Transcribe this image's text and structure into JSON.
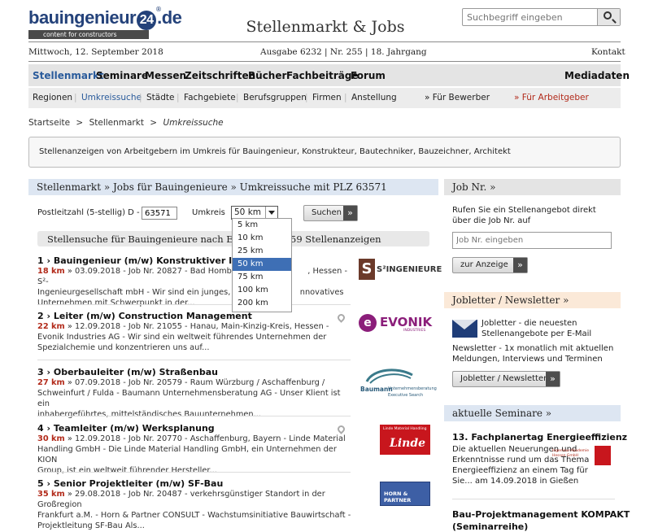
{
  "brand": {
    "logo_main": "bauingenieur",
    "logo_num": "24",
    "logo_tld": ".de",
    "logo_tagline": "content for constructors",
    "site_title": "Stellenmarkt & Jobs"
  },
  "search": {
    "placeholder": "Suchbegriff eingeben",
    "icon": "search-icon"
  },
  "dateline": {
    "date": "Mittwoch, 12. September 2018",
    "issue": "Ausgabe 6232 | Nr. 255 | 18. Jahrgang",
    "contact": "Kontakt"
  },
  "nav_main": {
    "items": [
      "Stellenmarkt",
      "Seminare",
      "Messen",
      "Zeitschriften",
      "Bücher",
      "Fachbeiträge",
      "Forum"
    ],
    "right": "Mediadaten",
    "active_color": "#2a5b9b"
  },
  "nav_sub": {
    "items": [
      "Regionen",
      "Umkreissuche",
      "Städte",
      "Fachgebiete",
      "Berufsgruppen",
      "Firmen",
      "Anstellung"
    ],
    "bewerber": "» Für Bewerber",
    "arbeitgeber": "» Für Arbeitgeber"
  },
  "breadcrumb": {
    "home": "Startseite",
    "sep": ">",
    "level1": "Stellenmarkt",
    "current": "Umkreissuche"
  },
  "intro_text": "Stellenanzeigen von Arbeitgebern im Umkreis für Bauingenieur, Konstrukteur, Bautechniker, Bauzeichner, Architekt",
  "main_panel": {
    "heading": "Stellenmarkt » Jobs für Bauingenieure » Umkreissuche mit PLZ 63571",
    "plz_label": "Postleitzahl (5-stellig)  D -",
    "plz_value": "63571",
    "radius_label": "Umkreis",
    "radius_selected": "50 km",
    "radius_options": [
      "5 km",
      "10 km",
      "25 km",
      "50 km",
      "75 km",
      "100 km",
      "200 km"
    ],
    "search_button": "Suchen",
    "results_heading_left": "Stellensuche für Bauingenieure nach E",
    "results_heading_right": "59 Stellenanzeigen"
  },
  "jobs": [
    {
      "title": "1 › Bauingenieur (m/w) Konstruktiver Ingeni",
      "km": "18 km",
      "line1": "» 03.09.2018 - Job Nr. 20827 - Bad Homburg,",
      "line1b": ", Hessen - S²-",
      "line2": "Ingenieurgesellschaft mbH - Wir sind ein junges, dyn",
      "line2b": "nnovatives",
      "line3": "Unternehmen mit Schwerpunkt in der...",
      "logo": "S²INGENIEURE"
    },
    {
      "title": "2 › Leiter (m/w) Construction Management",
      "km": "22 km",
      "line1": "» 12.09.2018 - Job Nr. 21055 - Hanau, Main-Kinzig-Kreis, Hessen -",
      "line2": "Evonik Industries AG - Wir sind ein weltweit führendes Unternehmen der",
      "line3": "Spezialchemie und konzentrieren uns auf...",
      "logo": "EVONIK",
      "logo_sub": "INDUSTRIES"
    },
    {
      "title": "3 › Oberbauleiter (m/w) Straßenbau",
      "km": "27 km",
      "line1": "» 07.09.2018 - Job Nr. 20579 - Raum Würzburg / Aschaffenburg /",
      "line2": "Schweinfurt / Fulda - Baumann Unternehmensberatung AG - Unser Klient ist ein",
      "line3": "inhabergeführtes, mittelständisches Bauunternehmen...",
      "logo": "Baumann",
      "logo_sub": "Unternehmensberatung",
      "logo_sub2": "Executive Search"
    },
    {
      "title": "4 › Teamleiter (m/w) Werksplanung",
      "km": "30 km",
      "line1": "» 12.09.2018 - Job Nr. 20770 - Aschaffenburg, Bayern - Linde Material",
      "line2": "Handling GmbH - Die Linde Material Handling GmbH, ein Unternehmen der KION",
      "line3": "Group, ist ein weltweit führender Hersteller...",
      "logo": "Linde",
      "logo_sub": "Linde Material Handling"
    },
    {
      "title": "5 › Senior Projektleiter (m/w) SF-Bau",
      "km": "35 km",
      "line1": "» 29.08.2018 - Job Nr. 20487 - verkehrsgünstiger Standort in der Großregion",
      "line2": "Frankfurt a.M. - Horn & Partner CONSULT - Wachstumsinitiative Bauwirtschaft -",
      "line3": "Projektleitung SF-Bau Als...",
      "logo": "HORN & PARTNER"
    }
  ],
  "sidebar": {
    "jobnr": {
      "heading": "Job Nr. »",
      "text": "Rufen Sie ein Stellenangebot direkt über die Job Nr. auf",
      "placeholder": "Job Nr. eingeben",
      "button": "zur Anzeige"
    },
    "newsletter": {
      "heading": "Jobletter / Newsletter »",
      "text1": "Jobletter - die neuesten Stellenangebote per E-Mail",
      "text2": "Newsletter - 1x monatlich mit aktuellen Meldungen, Interviews und Terminen",
      "button": "Jobletter / Newsletter"
    },
    "seminare": {
      "heading": "aktuelle Seminare »",
      "item1_title": "13. Fachplanertag Energieeffizienz",
      "item1_text": "Die aktuellen Neuerungen und Erkenntnisse rund um das Thema Energieeffizienz an einem Tag für Sie... am 14.09.2018 in Gießen",
      "item1_logo": "Ingenieur-Akademie Hessen GmbH",
      "item2_title": "Bau-Projektmanagement KOMPAKT",
      "item2_sub": "(Seminarreihe)"
    }
  },
  "colors": {
    "accent_blue": "#2a5b9b",
    "km_red": "#b22a1a",
    "panel_blue": "#dde6f2",
    "orange_head": "#fbe9d8"
  }
}
